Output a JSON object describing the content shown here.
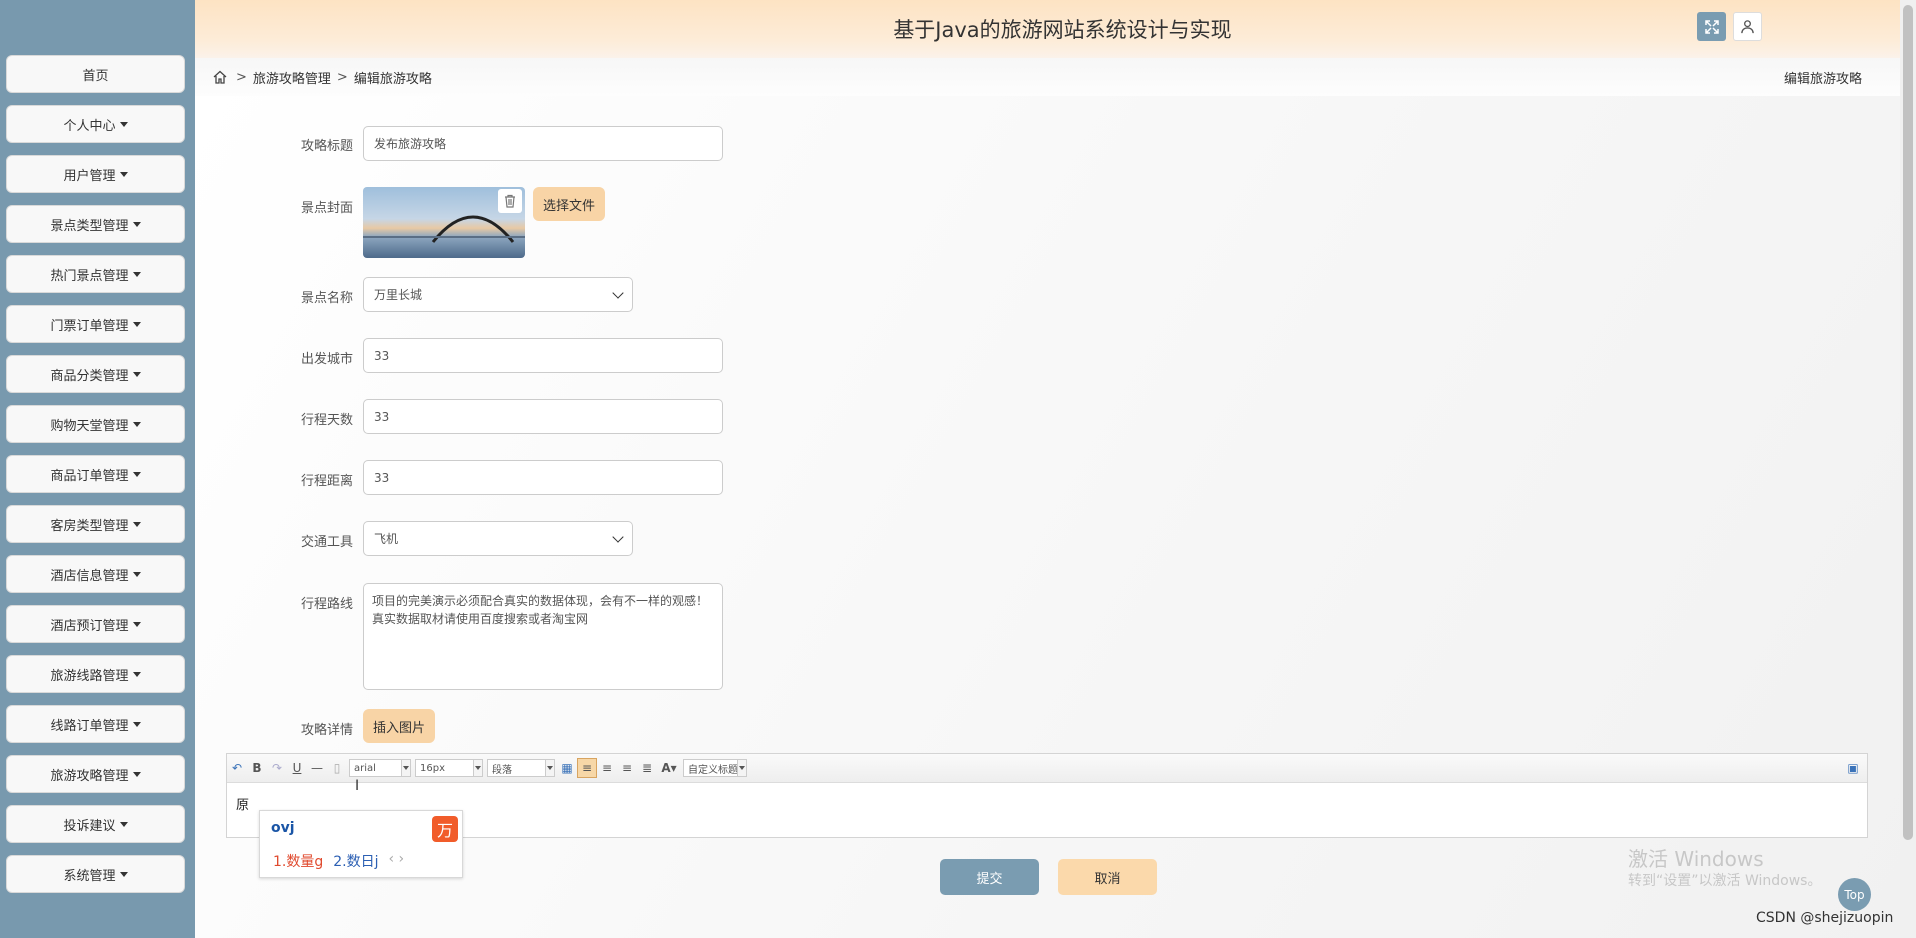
{
  "header": {
    "title": "基于Java的旅游网站系统设计与实现"
  },
  "sidebar": {
    "items": [
      {
        "label": "首页",
        "caret": false
      },
      {
        "label": "个人中心",
        "caret": true
      },
      {
        "label": "用户管理",
        "caret": true
      },
      {
        "label": "景点类型管理",
        "caret": true
      },
      {
        "label": "热门景点管理",
        "caret": true
      },
      {
        "label": "门票订单管理",
        "caret": true
      },
      {
        "label": "商品分类管理",
        "caret": true
      },
      {
        "label": "购物天堂管理",
        "caret": true
      },
      {
        "label": "商品订单管理",
        "caret": true
      },
      {
        "label": "客房类型管理",
        "caret": true
      },
      {
        "label": "酒店信息管理",
        "caret": true
      },
      {
        "label": "酒店预订管理",
        "caret": true
      },
      {
        "label": "旅游线路管理",
        "caret": true
      },
      {
        "label": "线路订单管理",
        "caret": true
      },
      {
        "label": "旅游攻略管理",
        "caret": true
      },
      {
        "label": "投诉建议",
        "caret": true
      },
      {
        "label": "系统管理",
        "caret": true
      }
    ]
  },
  "breadcrumb": {
    "sep": ">",
    "level1": "旅游攻略管理",
    "level2": "编辑旅游攻略",
    "right": "编辑旅游攻略"
  },
  "form": {
    "title_label": "攻略标题",
    "title_value": "发布旅游攻略",
    "cover_label": "景点封面",
    "choose_file": "选择文件",
    "spot_label": "景点名称",
    "spot_value": "万里长城",
    "city_label": "出发城市",
    "city_value": "33",
    "days_label": "行程天数",
    "days_value": "33",
    "distance_label": "行程距离",
    "distance_value": "33",
    "transport_label": "交通工具",
    "transport_value": "飞机",
    "route_label": "行程路线",
    "route_value": "项目的完美演示必须配合真实的数据体现，会有不一样的观感！真实数据取材请使用百度搜索或者淘宝网",
    "detail_label": "攻略详情",
    "insert_image": "插入图片"
  },
  "editor": {
    "font_family": "arial",
    "font_size": "16px",
    "paragraph": "段落",
    "custom_title": "自定义标题",
    "content": "原"
  },
  "ime": {
    "composition": "ovj",
    "candidate1": "1.数量g",
    "candidate2": "2.数日j",
    "arrows": "‹ ›"
  },
  "buttons": {
    "submit": "提交",
    "cancel": "取消",
    "top": "Top"
  },
  "overlay": {
    "activate_line1": "激活 Windows",
    "activate_line2": "转到“设置”以激活 Windows。",
    "watermark": "CSDN @shejizuopin"
  }
}
